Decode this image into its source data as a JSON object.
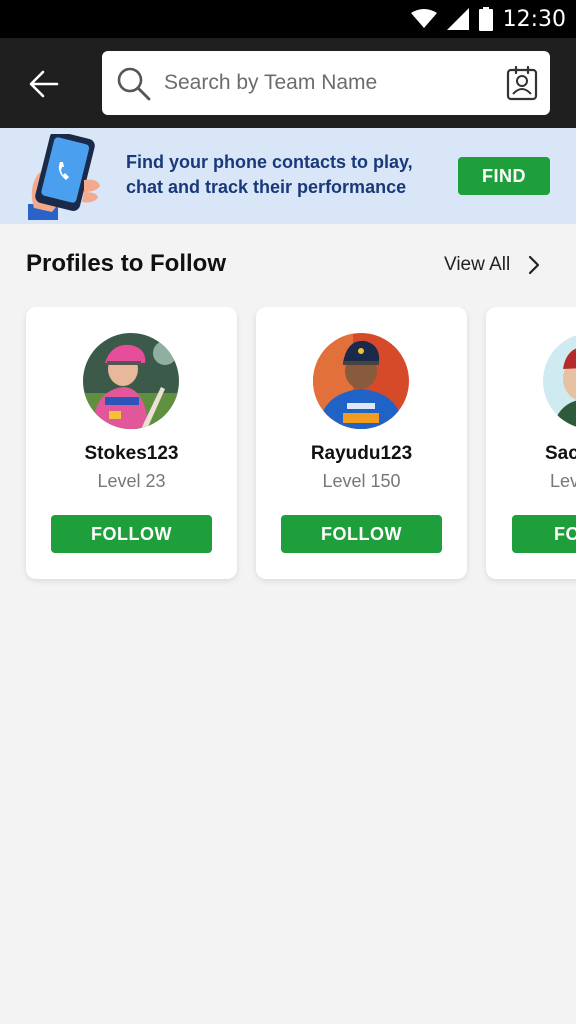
{
  "status_bar": {
    "time": "12:30",
    "icons": [
      "wifi-icon",
      "signal-icon",
      "battery-icon"
    ]
  },
  "header": {
    "back_icon": "arrow-left-icon",
    "search": {
      "placeholder": "Search by Team Name",
      "value": ""
    },
    "contact_icon": "contact-card-icon"
  },
  "banner": {
    "text": "Find your phone contacts to play, chat and track their performance",
    "button_label": "FIND",
    "illustration": "phone-in-hand-icon"
  },
  "section": {
    "title": "Profiles to Follow",
    "view_all_label": "View All",
    "view_all_icon": "chevron-right-icon"
  },
  "profiles": [
    {
      "name": "Stokes123",
      "level": "Level 23",
      "follow_label": "FOLLOW"
    },
    {
      "name": "Rayudu123",
      "level": "Level 150",
      "follow_label": "FOLLOW"
    },
    {
      "name": "Sac",
      "level": "Lev",
      "follow_label": "FO"
    }
  ],
  "colors": {
    "header_bg": "#1f1f1f",
    "banner_bg": "#d9e6f7",
    "banner_text": "#193a7a",
    "accent_green": "#1e9f3c",
    "page_bg": "#f3f3f3"
  }
}
